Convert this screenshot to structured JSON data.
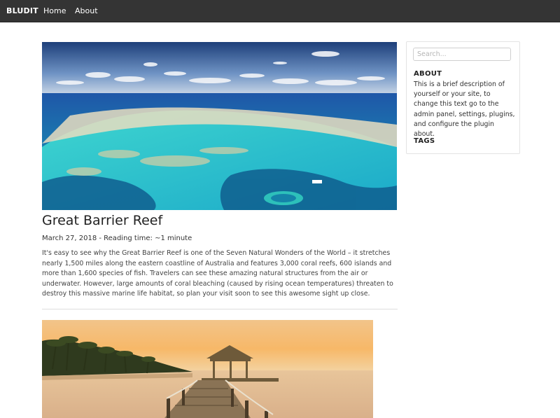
{
  "navbar": {
    "brand": "BLUDIT",
    "links": [
      {
        "label": "Home"
      },
      {
        "label": "About"
      }
    ]
  },
  "posts": [
    {
      "title": "Great Barrier Reef",
      "date": "March 27, 2018",
      "reading_time": "Reading time: ~1 minute",
      "meta": "March 27, 2018 - Reading time: ~1 minute",
      "content": "It's easy to see why the Great Barrier Reef is one of the Seven Natural Wonders of the World – it stretches nearly 1,500 miles along the eastern coastline of Australia and features 3,000 coral reefs, 600 islands and more than 1,600 species of fish. Travelers can see these amazing natural structures from the air or underwater. However, large amounts of coral bleaching (caused by rising ocean temperatures) threaten to destroy this massive marine life habitat, so plan your visit soon to see this awesome sight up close.",
      "image_icon": "reef-aerial-image"
    },
    {
      "image_icon": "tropical-pier-sunset-image"
    }
  ],
  "sidebar": {
    "search": {
      "placeholder": "Search...",
      "value": ""
    },
    "about": {
      "heading": "ABOUT",
      "text": "This is a brief description of yourself or your site, to change this text go to the admin panel, settings, plugins, and configure the plugin about."
    },
    "tags": {
      "heading": "TAGS"
    }
  },
  "colors": {
    "navbar_bg": "#343434",
    "navbar_text": "#ffffff",
    "divider": "#dddddd"
  }
}
